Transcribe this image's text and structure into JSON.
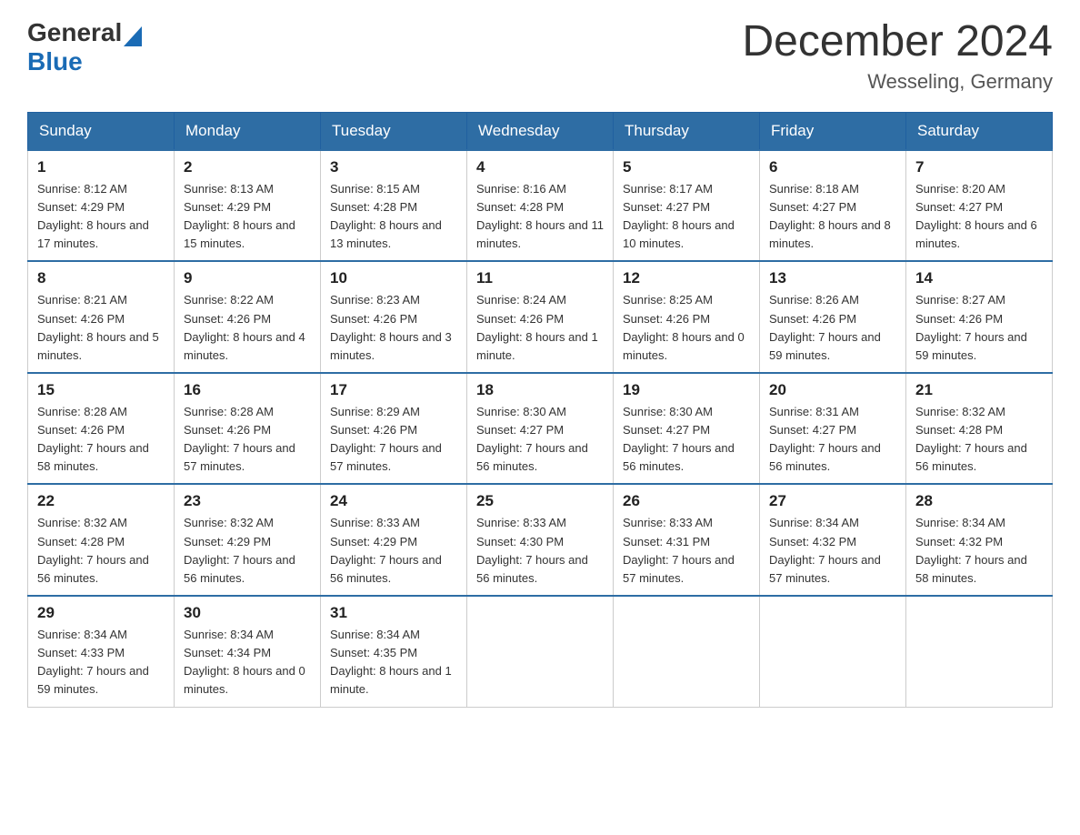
{
  "logo": {
    "general": "General",
    "blue": "Blue"
  },
  "title": "December 2024",
  "location": "Wesseling, Germany",
  "days_of_week": [
    "Sunday",
    "Monday",
    "Tuesday",
    "Wednesday",
    "Thursday",
    "Friday",
    "Saturday"
  ],
  "weeks": [
    [
      {
        "day": "1",
        "sunrise": "8:12 AM",
        "sunset": "4:29 PM",
        "daylight": "8 hours and 17 minutes."
      },
      {
        "day": "2",
        "sunrise": "8:13 AM",
        "sunset": "4:29 PM",
        "daylight": "8 hours and 15 minutes."
      },
      {
        "day": "3",
        "sunrise": "8:15 AM",
        "sunset": "4:28 PM",
        "daylight": "8 hours and 13 minutes."
      },
      {
        "day": "4",
        "sunrise": "8:16 AM",
        "sunset": "4:28 PM",
        "daylight": "8 hours and 11 minutes."
      },
      {
        "day": "5",
        "sunrise": "8:17 AM",
        "sunset": "4:27 PM",
        "daylight": "8 hours and 10 minutes."
      },
      {
        "day": "6",
        "sunrise": "8:18 AM",
        "sunset": "4:27 PM",
        "daylight": "8 hours and 8 minutes."
      },
      {
        "day": "7",
        "sunrise": "8:20 AM",
        "sunset": "4:27 PM",
        "daylight": "8 hours and 6 minutes."
      }
    ],
    [
      {
        "day": "8",
        "sunrise": "8:21 AM",
        "sunset": "4:26 PM",
        "daylight": "8 hours and 5 minutes."
      },
      {
        "day": "9",
        "sunrise": "8:22 AM",
        "sunset": "4:26 PM",
        "daylight": "8 hours and 4 minutes."
      },
      {
        "day": "10",
        "sunrise": "8:23 AM",
        "sunset": "4:26 PM",
        "daylight": "8 hours and 3 minutes."
      },
      {
        "day": "11",
        "sunrise": "8:24 AM",
        "sunset": "4:26 PM",
        "daylight": "8 hours and 1 minute."
      },
      {
        "day": "12",
        "sunrise": "8:25 AM",
        "sunset": "4:26 PM",
        "daylight": "8 hours and 0 minutes."
      },
      {
        "day": "13",
        "sunrise": "8:26 AM",
        "sunset": "4:26 PM",
        "daylight": "7 hours and 59 minutes."
      },
      {
        "day": "14",
        "sunrise": "8:27 AM",
        "sunset": "4:26 PM",
        "daylight": "7 hours and 59 minutes."
      }
    ],
    [
      {
        "day": "15",
        "sunrise": "8:28 AM",
        "sunset": "4:26 PM",
        "daylight": "7 hours and 58 minutes."
      },
      {
        "day": "16",
        "sunrise": "8:28 AM",
        "sunset": "4:26 PM",
        "daylight": "7 hours and 57 minutes."
      },
      {
        "day": "17",
        "sunrise": "8:29 AM",
        "sunset": "4:26 PM",
        "daylight": "7 hours and 57 minutes."
      },
      {
        "day": "18",
        "sunrise": "8:30 AM",
        "sunset": "4:27 PM",
        "daylight": "7 hours and 56 minutes."
      },
      {
        "day": "19",
        "sunrise": "8:30 AM",
        "sunset": "4:27 PM",
        "daylight": "7 hours and 56 minutes."
      },
      {
        "day": "20",
        "sunrise": "8:31 AM",
        "sunset": "4:27 PM",
        "daylight": "7 hours and 56 minutes."
      },
      {
        "day": "21",
        "sunrise": "8:32 AM",
        "sunset": "4:28 PM",
        "daylight": "7 hours and 56 minutes."
      }
    ],
    [
      {
        "day": "22",
        "sunrise": "8:32 AM",
        "sunset": "4:28 PM",
        "daylight": "7 hours and 56 minutes."
      },
      {
        "day": "23",
        "sunrise": "8:32 AM",
        "sunset": "4:29 PM",
        "daylight": "7 hours and 56 minutes."
      },
      {
        "day": "24",
        "sunrise": "8:33 AM",
        "sunset": "4:29 PM",
        "daylight": "7 hours and 56 minutes."
      },
      {
        "day": "25",
        "sunrise": "8:33 AM",
        "sunset": "4:30 PM",
        "daylight": "7 hours and 56 minutes."
      },
      {
        "day": "26",
        "sunrise": "8:33 AM",
        "sunset": "4:31 PM",
        "daylight": "7 hours and 57 minutes."
      },
      {
        "day": "27",
        "sunrise": "8:34 AM",
        "sunset": "4:32 PM",
        "daylight": "7 hours and 57 minutes."
      },
      {
        "day": "28",
        "sunrise": "8:34 AM",
        "sunset": "4:32 PM",
        "daylight": "7 hours and 58 minutes."
      }
    ],
    [
      {
        "day": "29",
        "sunrise": "8:34 AM",
        "sunset": "4:33 PM",
        "daylight": "7 hours and 59 minutes."
      },
      {
        "day": "30",
        "sunrise": "8:34 AM",
        "sunset": "4:34 PM",
        "daylight": "8 hours and 0 minutes."
      },
      {
        "day": "31",
        "sunrise": "8:34 AM",
        "sunset": "4:35 PM",
        "daylight": "8 hours and 1 minute."
      },
      null,
      null,
      null,
      null
    ]
  ],
  "labels": {
    "sunrise": "Sunrise:",
    "sunset": "Sunset:",
    "daylight": "Daylight:"
  }
}
